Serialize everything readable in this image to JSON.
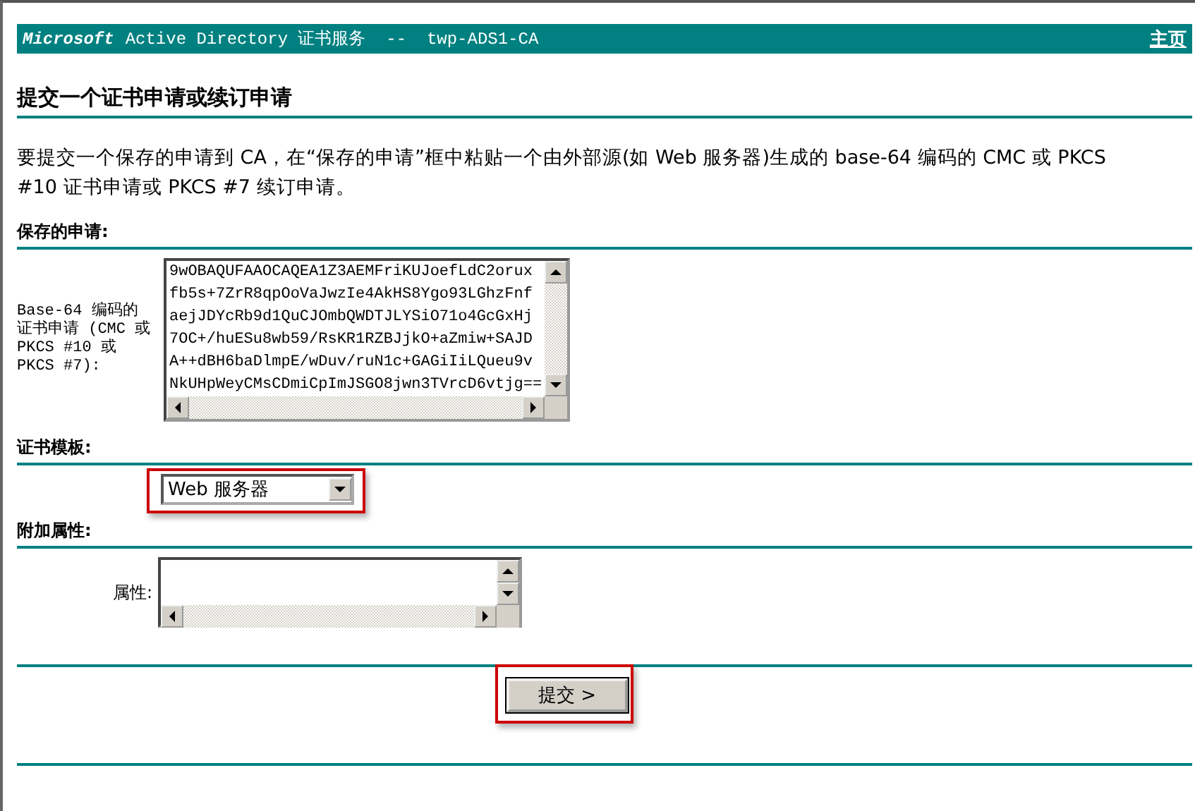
{
  "header": {
    "brand": "Microsoft",
    "title": "Active Directory 证书服务  --  twp-ADS1-CA",
    "home_link": "主页"
  },
  "page_title": "提交一个证书申请或续订申请",
  "intro": "要提交一个保存的申请到 CA，在“保存的申请”框中粘贴一个由外部源(如 Web 服务器)生成的 base-64 编码的 CMC 或 PKCS #10 证书申请或 PKCS #7 续订申请。",
  "sections": [
    {
      "kind": "request",
      "heading": "保存的申请:",
      "label": "Base-64 编码的证书申请 (CMC 或 PKCS #10 或 PKCS #7):",
      "lines": [
        "9wOBAQUFAAOCAQEA1Z3AEMFriKUJoefLdC2orux",
        "fb5s+7ZrR8qpOoVaJwzIe4AkHS8Ygo93LGhzFnf",
        "aejJDYcRb9d1QuCJOmbQWDTJLYSiO71o4GcGxHj",
        "7OC+/huESu8wb59/RsKR1RZBJjkO+aZmiw+SAJD",
        "A++dBH6baDlmpE/wDuv/ruN1c+GAGiIiLQueu9v",
        "NkUHpWeyCMsCDmiCpImJSGO8jwn3TVrcD6vtjg=="
      ]
    },
    {
      "kind": "template",
      "heading": "证书模板:",
      "value": "Web 服务器",
      "highlighted": true
    },
    {
      "kind": "attributes",
      "heading": "附加属性:",
      "label": "属性:"
    }
  ],
  "submit": {
    "label": "提交 >",
    "highlighted": true
  }
}
